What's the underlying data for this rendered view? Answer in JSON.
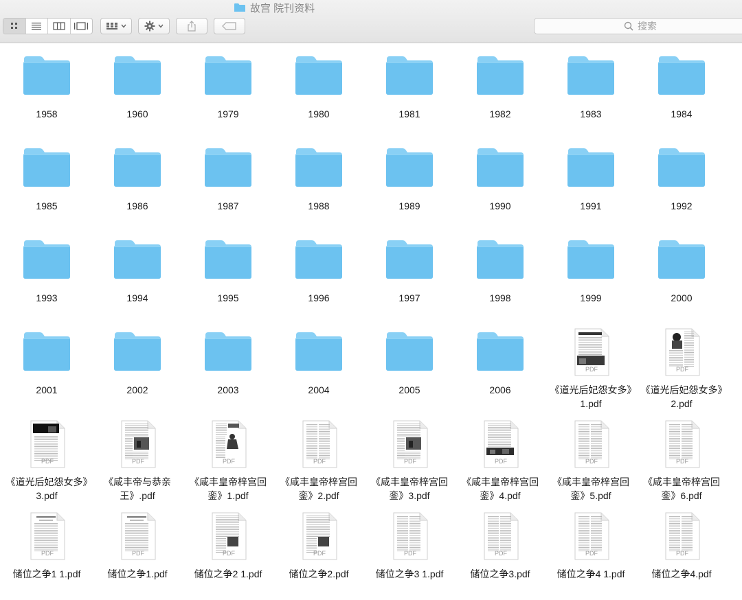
{
  "window": {
    "title": "故宫 院刊资料"
  },
  "toolbar": {
    "view_modes": [
      "icon-view",
      "list-view",
      "column-view",
      "gallery-view"
    ],
    "arrange_icon": "arrange-icon",
    "action_icon": "gear-icon",
    "share_icon": "share-icon",
    "tag_icon": "tag-icon",
    "search_placeholder": "搜索"
  },
  "colors": {
    "folder": "#6cc2f0",
    "folder_tab": "#89d0f5",
    "toolbar_bg": "#e9e9e9"
  },
  "items": [
    {
      "type": "folder",
      "name": "1958"
    },
    {
      "type": "folder",
      "name": "1960"
    },
    {
      "type": "folder",
      "name": "1979"
    },
    {
      "type": "folder",
      "name": "1980"
    },
    {
      "type": "folder",
      "name": "1981"
    },
    {
      "type": "folder",
      "name": "1982"
    },
    {
      "type": "folder",
      "name": "1983"
    },
    {
      "type": "folder",
      "name": "1984"
    },
    {
      "type": "folder",
      "name": "1985"
    },
    {
      "type": "folder",
      "name": "1986"
    },
    {
      "type": "folder",
      "name": "1987"
    },
    {
      "type": "folder",
      "name": "1988"
    },
    {
      "type": "folder",
      "name": "1989"
    },
    {
      "type": "folder",
      "name": "1990"
    },
    {
      "type": "folder",
      "name": "1991"
    },
    {
      "type": "folder",
      "name": "1992"
    },
    {
      "type": "folder",
      "name": "1993"
    },
    {
      "type": "folder",
      "name": "1994"
    },
    {
      "type": "folder",
      "name": "1995"
    },
    {
      "type": "folder",
      "name": "1996"
    },
    {
      "type": "folder",
      "name": "1997"
    },
    {
      "type": "folder",
      "name": "1998"
    },
    {
      "type": "folder",
      "name": "1999"
    },
    {
      "type": "folder",
      "name": "2000"
    },
    {
      "type": "folder",
      "name": "2001"
    },
    {
      "type": "folder",
      "name": "2002"
    },
    {
      "type": "folder",
      "name": "2003"
    },
    {
      "type": "folder",
      "name": "2004"
    },
    {
      "type": "folder",
      "name": "2005"
    },
    {
      "type": "folder",
      "name": "2006"
    },
    {
      "type": "pdf",
      "name": "《道光后妃怨女多》1.pdf",
      "thumb": "photo-top"
    },
    {
      "type": "pdf",
      "name": "《道光后妃怨女多》2.pdf",
      "thumb": "portrait"
    },
    {
      "type": "pdf",
      "name": "《道光后妃怨女多》3.pdf",
      "thumb": "dark-top"
    },
    {
      "type": "pdf",
      "name": "《咸丰帝与恭亲王》.pdf",
      "thumb": "photo-mid"
    },
    {
      "type": "pdf",
      "name": "《咸丰皇帝梓宫回銮》1.pdf",
      "thumb": "portrait-seated"
    },
    {
      "type": "pdf",
      "name": "《咸丰皇帝梓宫回銮》2.pdf",
      "thumb": "text"
    },
    {
      "type": "pdf",
      "name": "《咸丰皇帝梓宫回銮》3.pdf",
      "thumb": "photo-mid"
    },
    {
      "type": "pdf",
      "name": "《咸丰皇帝梓宫回銮》4.pdf",
      "thumb": "photo-wide"
    },
    {
      "type": "pdf",
      "name": "《咸丰皇帝梓宫回銮》5.pdf",
      "thumb": "text"
    },
    {
      "type": "pdf",
      "name": "《咸丰皇帝梓宫回銮》6.pdf",
      "thumb": "text"
    },
    {
      "type": "pdf",
      "name": "储位之争1 1.pdf",
      "thumb": "text-header"
    },
    {
      "type": "pdf",
      "name": "储位之争1.pdf",
      "thumb": "text-header"
    },
    {
      "type": "pdf",
      "name": "储位之争2 1.pdf",
      "thumb": "photo-small"
    },
    {
      "type": "pdf",
      "name": "储位之争2.pdf",
      "thumb": "photo-small"
    },
    {
      "type": "pdf",
      "name": "储位之争3 1.pdf",
      "thumb": "text"
    },
    {
      "type": "pdf",
      "name": "储位之争3.pdf",
      "thumb": "text"
    },
    {
      "type": "pdf",
      "name": "储位之争4 1.pdf",
      "thumb": "text"
    },
    {
      "type": "pdf",
      "name": "储位之争4.pdf",
      "thumb": "text"
    }
  ],
  "pdf_tag": "PDF"
}
